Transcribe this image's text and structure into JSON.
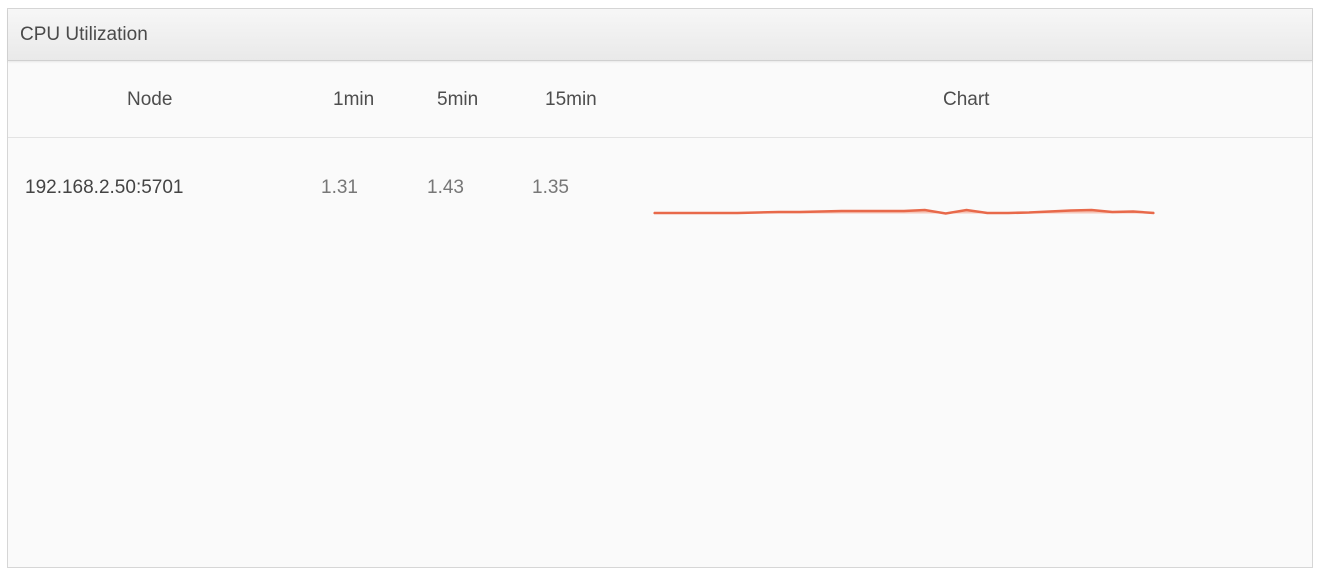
{
  "panel": {
    "title": "CPU Utilization"
  },
  "table": {
    "columns": {
      "node": "Node",
      "min1": "1min",
      "min5": "5min",
      "min15": "15min",
      "chart": "Chart"
    },
    "rows": [
      {
        "node": "192.168.2.50:5701",
        "min1": "1.31",
        "min5": "1.43",
        "min15": "1.35"
      }
    ]
  },
  "colors": {
    "sparkline_stroke": "#e8694a",
    "sparkline_fill": "#f2a58f"
  },
  "chart_data": {
    "type": "area",
    "series": [
      {
        "values": [
          1.3,
          1.3,
          1.3,
          1.3,
          1.3,
          1.31,
          1.32,
          1.32,
          1.33,
          1.34,
          1.34,
          1.34,
          1.34,
          1.36,
          1.29,
          1.36,
          1.3,
          1.3,
          1.31,
          1.33,
          1.35,
          1.36,
          1.32,
          1.33,
          1.3
        ]
      }
    ]
  }
}
